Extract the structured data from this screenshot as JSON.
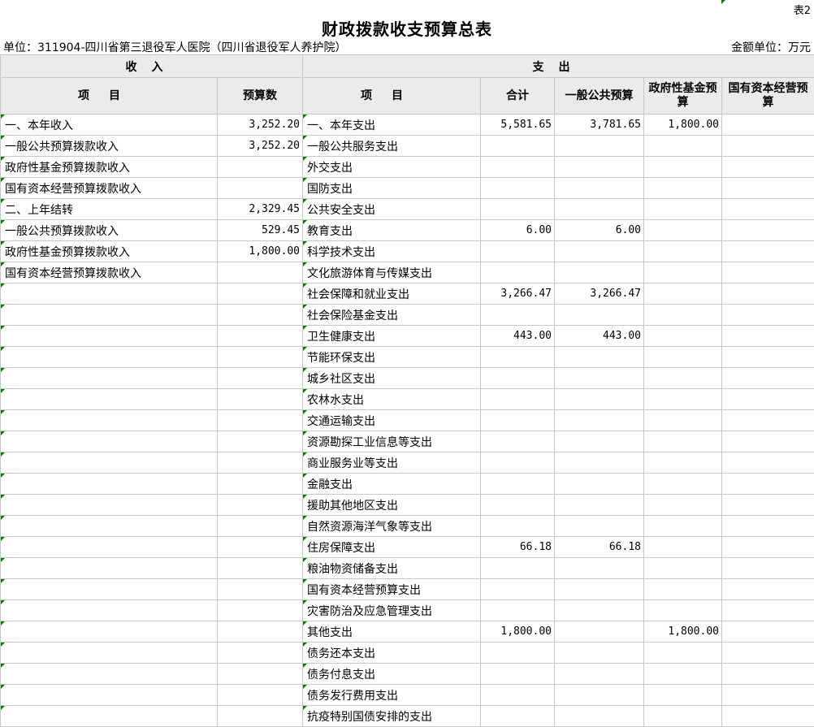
{
  "table_no": "表2",
  "title": "财政拨款收支预算总表",
  "unit_label": "单位：311904-四川省第三退役军人医院（四川省退役军人养护院）",
  "amount_unit": "金额单位：万元",
  "headers": {
    "income": "收入",
    "expense": "支出",
    "item": "项目",
    "budget": "预算数",
    "exp_item": "项目",
    "total": "合计",
    "general": "一般公共预算",
    "gov_fund": "政府性基金预算",
    "state_capital": "国有资本经营预算"
  },
  "rows": [
    {
      "in_item": "一、本年收入",
      "in_val": "3,252.20",
      "ex_item": "一、本年支出",
      "total": "5,581.65",
      "general": "3,781.65",
      "gov": "1,800.00",
      "state": ""
    },
    {
      "in_item": "一般公共预算拨款收入",
      "in_val": "3,252.20",
      "ex_item": "一般公共服务支出",
      "total": "",
      "general": "",
      "gov": "",
      "state": ""
    },
    {
      "in_item": "政府性基金预算拨款收入",
      "in_val": "",
      "ex_item": "外交支出",
      "total": "",
      "general": "",
      "gov": "",
      "state": ""
    },
    {
      "in_item": "国有资本经营预算拨款收入",
      "in_val": "",
      "ex_item": "国防支出",
      "total": "",
      "general": "",
      "gov": "",
      "state": ""
    },
    {
      "in_item": "二、上年结转",
      "in_val": "2,329.45",
      "ex_item": "公共安全支出",
      "total": "",
      "general": "",
      "gov": "",
      "state": ""
    },
    {
      "in_item": "一般公共预算拨款收入",
      "in_val": "529.45",
      "ex_item": "教育支出",
      "total": "6.00",
      "general": "6.00",
      "gov": "",
      "state": ""
    },
    {
      "in_item": "政府性基金预算拨款收入",
      "in_val": "1,800.00",
      "ex_item": "科学技术支出",
      "total": "",
      "general": "",
      "gov": "",
      "state": ""
    },
    {
      "in_item": "国有资本经营预算拨款收入",
      "in_val": "",
      "ex_item": "文化旅游体育与传媒支出",
      "total": "",
      "general": "",
      "gov": "",
      "state": ""
    },
    {
      "in_item": "",
      "in_val": "",
      "ex_item": "社会保障和就业支出",
      "total": "3,266.47",
      "general": "3,266.47",
      "gov": "",
      "state": ""
    },
    {
      "in_item": "",
      "in_val": "",
      "ex_item": "社会保险基金支出",
      "total": "",
      "general": "",
      "gov": "",
      "state": ""
    },
    {
      "in_item": "",
      "in_val": "",
      "ex_item": "卫生健康支出",
      "total": "443.00",
      "general": "443.00",
      "gov": "",
      "state": ""
    },
    {
      "in_item": "",
      "in_val": "",
      "ex_item": "节能环保支出",
      "total": "",
      "general": "",
      "gov": "",
      "state": ""
    },
    {
      "in_item": "",
      "in_val": "",
      "ex_item": "城乡社区支出",
      "total": "",
      "general": "",
      "gov": "",
      "state": ""
    },
    {
      "in_item": "",
      "in_val": "",
      "ex_item": "农林水支出",
      "total": "",
      "general": "",
      "gov": "",
      "state": ""
    },
    {
      "in_item": "",
      "in_val": "",
      "ex_item": "交通运输支出",
      "total": "",
      "general": "",
      "gov": "",
      "state": ""
    },
    {
      "in_item": "",
      "in_val": "",
      "ex_item": "资源勘探工业信息等支出",
      "total": "",
      "general": "",
      "gov": "",
      "state": ""
    },
    {
      "in_item": "",
      "in_val": "",
      "ex_item": "商业服务业等支出",
      "total": "",
      "general": "",
      "gov": "",
      "state": ""
    },
    {
      "in_item": "",
      "in_val": "",
      "ex_item": "金融支出",
      "total": "",
      "general": "",
      "gov": "",
      "state": ""
    },
    {
      "in_item": "",
      "in_val": "",
      "ex_item": "援助其他地区支出",
      "total": "",
      "general": "",
      "gov": "",
      "state": ""
    },
    {
      "in_item": "",
      "in_val": "",
      "ex_item": "自然资源海洋气象等支出",
      "total": "",
      "general": "",
      "gov": "",
      "state": ""
    },
    {
      "in_item": "",
      "in_val": "",
      "ex_item": "住房保障支出",
      "total": "66.18",
      "general": "66.18",
      "gov": "",
      "state": ""
    },
    {
      "in_item": "",
      "in_val": "",
      "ex_item": "粮油物资储备支出",
      "total": "",
      "general": "",
      "gov": "",
      "state": ""
    },
    {
      "in_item": "",
      "in_val": "",
      "ex_item": "国有资本经营预算支出",
      "total": "",
      "general": "",
      "gov": "",
      "state": ""
    },
    {
      "in_item": "",
      "in_val": "",
      "ex_item": "灾害防治及应急管理支出",
      "total": "",
      "general": "",
      "gov": "",
      "state": ""
    },
    {
      "in_item": "",
      "in_val": "",
      "ex_item": "其他支出",
      "total": "1,800.00",
      "general": "",
      "gov": "1,800.00",
      "state": ""
    },
    {
      "in_item": "",
      "in_val": "",
      "ex_item": "债务还本支出",
      "total": "",
      "general": "",
      "gov": "",
      "state": ""
    },
    {
      "in_item": "",
      "in_val": "",
      "ex_item": "债务付息支出",
      "total": "",
      "general": "",
      "gov": "",
      "state": ""
    },
    {
      "in_item": "",
      "in_val": "",
      "ex_item": "债务发行费用支出",
      "total": "",
      "general": "",
      "gov": "",
      "state": ""
    },
    {
      "in_item": "",
      "in_val": "",
      "ex_item": "抗疫特别国债安排的支出",
      "total": "",
      "general": "",
      "gov": "",
      "state": ""
    }
  ]
}
